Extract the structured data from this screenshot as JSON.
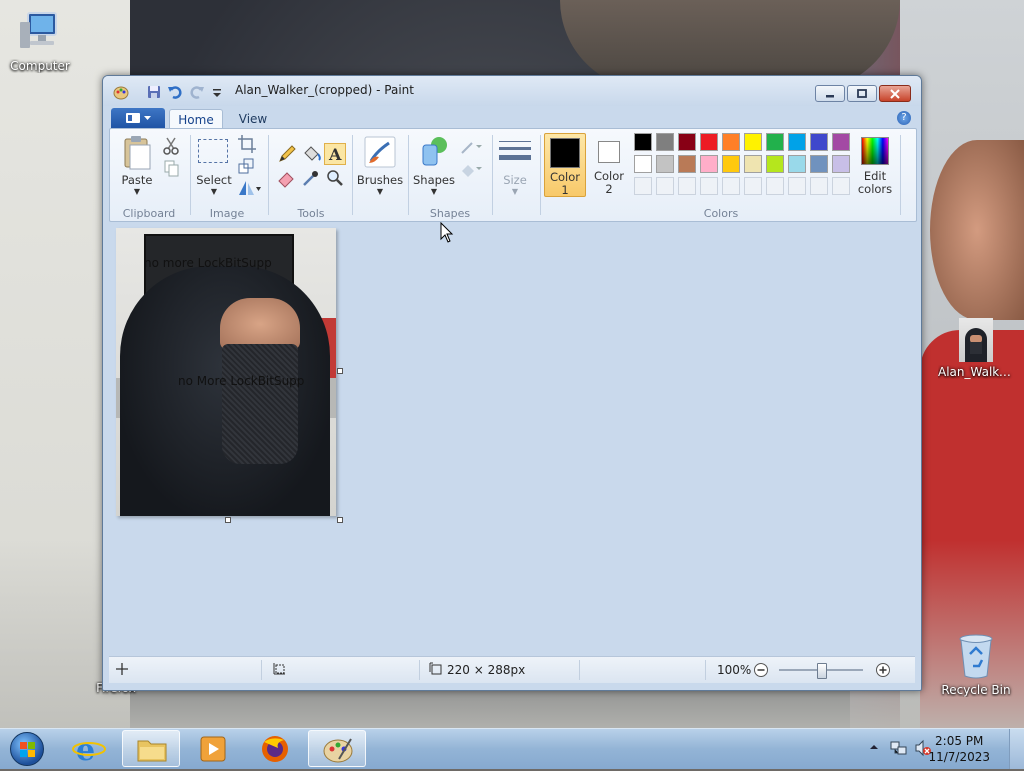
{
  "desktop": {
    "icons": [
      {
        "label": "Computer"
      },
      {
        "label": "Alan_Walker..."
      },
      {
        "label": "Firefox"
      },
      {
        "label": "Recycle Bin"
      }
    ]
  },
  "window": {
    "title": "Alan_Walker_(cropped) - Paint"
  },
  "ribbon": {
    "tabs": [
      "Home",
      "View"
    ],
    "clipboard": {
      "paste_label": "Paste",
      "group_label": "Clipboard"
    },
    "image": {
      "select_label": "Select",
      "group_label": "Image"
    },
    "tools": {
      "group_label": "Tools"
    },
    "brushes": {
      "label": "Brushes"
    },
    "shapes": {
      "label": "Shapes",
      "group_label": "Shapes"
    },
    "size": {
      "label": "Size"
    },
    "colors": {
      "color1_label": "Color",
      "color1_num": "1",
      "color2_label": "Color",
      "color2_num": "2",
      "edit_label": "Edit",
      "edit_label2": "colors",
      "group_label": "Colors",
      "color1_value": "#000000",
      "color2_value": "#ffffff",
      "palette_row1": [
        "#000000",
        "#7f7f7f",
        "#880015",
        "#ed1c24",
        "#ff7f27",
        "#fff200",
        "#22b14c",
        "#00a2e8",
        "#3f48cc",
        "#a349a4"
      ],
      "palette_row2": [
        "#ffffff",
        "#c3c3c3",
        "#b97a57",
        "#ffaec9",
        "#ffc90e",
        "#efe4b0",
        "#b5e61d",
        "#99d9ea",
        "#7092be",
        "#c8bfe7"
      ]
    }
  },
  "canvas": {
    "text1": "no more LockBitSupp",
    "text2": "no More LockBitSupp"
  },
  "statusbar": {
    "image_size": "220 × 288px",
    "zoom": "100%"
  },
  "taskbar": {
    "time": "2:05 PM",
    "date": "11/7/2023"
  }
}
